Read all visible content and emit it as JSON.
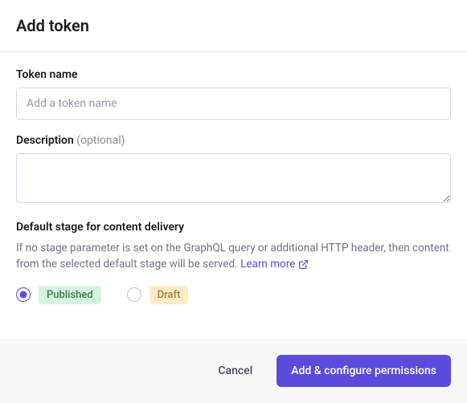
{
  "header": {
    "title": "Add token"
  },
  "fields": {
    "tokenName": {
      "label": "Token name",
      "placeholder": "Add a token name",
      "value": ""
    },
    "description": {
      "label": "Description",
      "optional": "(optional)",
      "value": ""
    },
    "defaultStage": {
      "label": "Default stage for content delivery",
      "help": "If no stage parameter is set on the GraphQL query or additional HTTP header, then content from the selected default stage will be served.",
      "learnMore": "Learn more",
      "options": {
        "published": "Published",
        "draft": "Draft"
      },
      "selected": "published"
    }
  },
  "footer": {
    "cancel": "Cancel",
    "submit": "Add & configure permissions"
  }
}
